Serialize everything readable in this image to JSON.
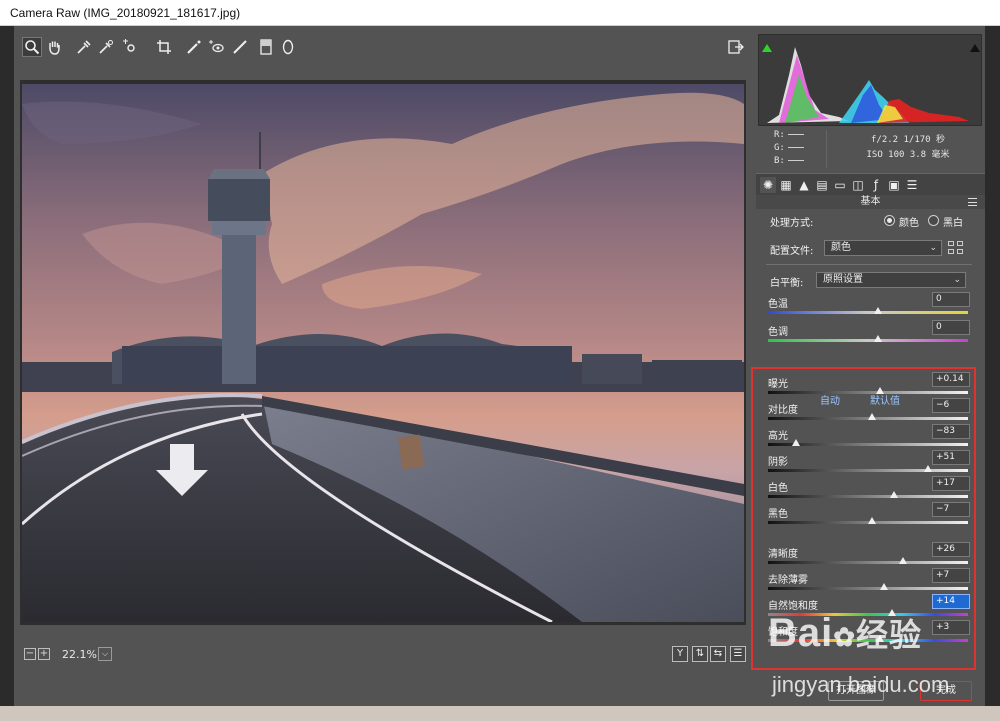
{
  "window": {
    "title": "Camera Raw (IMG_20180921_181617.jpg)"
  },
  "toolbar": {
    "tools": [
      "zoom-icon",
      "hand-icon",
      "white-balance-icon",
      "color-sampler-icon",
      "targeted-adjust-icon",
      "crop-icon",
      "spot-removal-icon",
      "red-eye-icon",
      "brush-icon",
      "graduated-filter-icon",
      "radial-filter-icon"
    ],
    "share": "export-icon"
  },
  "status": {
    "zoom_minus": "−",
    "zoom_plus": "+",
    "zoom_level": "22.1%",
    "zoom_caret": "⌵",
    "view_y": "Y",
    "view_b": "⇅",
    "view_c": "⇆",
    "view_d": "☰"
  },
  "histogram": {
    "r_label": "R:",
    "g_label": "G:",
    "b_label": "B:",
    "aperture_shutter": "f/2.2  1/170 秒",
    "iso_focal": "ISO 100  3.8 毫米"
  },
  "panel": {
    "title": "基本",
    "treatment_label": "处理方式:",
    "treatment_color": "颜色",
    "treatment_bw": "黑白",
    "profile_label": "配置文件:",
    "profile_value": "颜色",
    "wb_label": "白平衡:",
    "wb_value": "原照设置",
    "auto_link": "自动",
    "default_link": "默认值",
    "sliders": [
      {
        "label": "色温",
        "value": "0"
      },
      {
        "label": "色调",
        "value": "0"
      },
      {
        "label": "曝光",
        "value": "+0.14"
      },
      {
        "label": "对比度",
        "value": "−6"
      },
      {
        "label": "高光",
        "value": "−83"
      },
      {
        "label": "阴影",
        "value": "+51"
      },
      {
        "label": "白色",
        "value": "+17"
      },
      {
        "label": "黑色",
        "value": "−7"
      },
      {
        "label": "清晰度",
        "value": "+26"
      },
      {
        "label": "去除薄雾",
        "value": "+7"
      },
      {
        "label": "自然饱和度",
        "value": "+14"
      },
      {
        "label": "饱和度",
        "value": "+3"
      }
    ]
  },
  "buttons": {
    "open": "打开图像",
    "done": "完成"
  },
  "watermark": {
    "brand": "Bai",
    "brand2": "经验",
    "url": "jingyan.baidu.com"
  },
  "colors": {
    "accent_red": "#e0322e",
    "focus_blue": "#1f6ad0",
    "panel_bg": "#535353"
  }
}
